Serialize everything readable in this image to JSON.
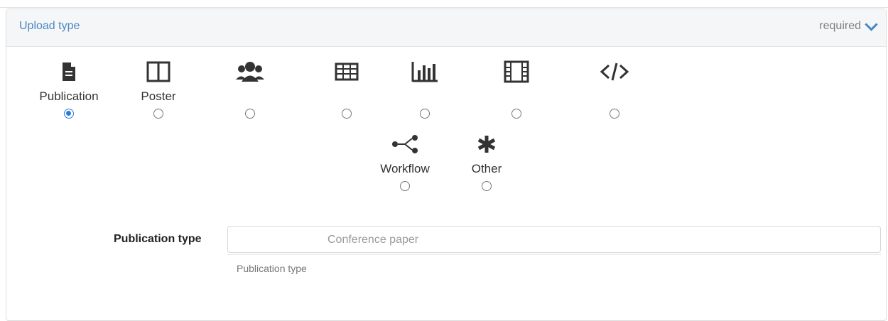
{
  "header": {
    "title": "Upload type",
    "required_label": "required"
  },
  "types": [
    {
      "label": "Publication",
      "icon": "document-icon",
      "selected": true
    },
    {
      "label": "Poster",
      "icon": "poster-icon",
      "selected": false
    },
    {
      "label": "",
      "icon": "people-icon",
      "selected": false
    },
    {
      "label": "",
      "icon": "table-icon",
      "selected": false
    },
    {
      "label": "",
      "icon": "bar-chart-icon",
      "selected": false
    },
    {
      "label": "",
      "icon": "film-icon",
      "selected": false
    },
    {
      "label": "",
      "icon": "code-icon",
      "selected": false
    },
    {
      "label": "Workflow",
      "icon": "workflow-icon",
      "selected": false
    },
    {
      "label": "Other",
      "icon": "asterisk-icon",
      "selected": false
    }
  ],
  "publication_type": {
    "label": "Publication type",
    "value": "Conference paper",
    "help": "Publication type"
  }
}
